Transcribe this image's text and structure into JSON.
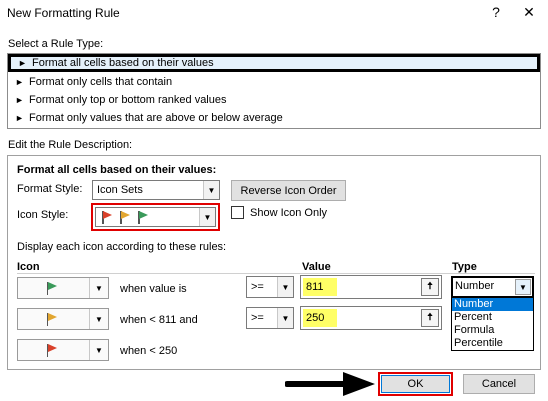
{
  "dialog": {
    "title": "New Formatting Rule",
    "help_glyph": "?",
    "close_glyph": "✕"
  },
  "rule_type": {
    "label": "Select a Rule Type:",
    "items": [
      {
        "label": "Format all cells based on their values",
        "selected": true
      },
      {
        "label": "Format only cells that contain",
        "selected": false
      },
      {
        "label": "Format only top or bottom ranked values",
        "selected": false
      },
      {
        "label": "Format only values that are above or below average",
        "selected": false
      }
    ]
  },
  "description": {
    "label": "Edit the Rule Description:",
    "heading": "Format all cells based on their values:",
    "format_style_label": "Format Style:",
    "format_style_value": "Icon Sets",
    "reverse_button": "Reverse Icon Order",
    "icon_style_label": "Icon Style:",
    "show_icon_only_label": "Show Icon Only",
    "show_icon_only_checked": false,
    "rules_text": "Display each icon according to these rules:",
    "col_icon": "Icon",
    "col_value": "Value",
    "col_type": "Type"
  },
  "rules": [
    {
      "condition": "when value is",
      "operator": ">=",
      "value": "811",
      "type": "Number",
      "flag_color": "#3a9a5a"
    },
    {
      "condition": "when < 811 and",
      "operator": ">=",
      "value": "250",
      "type": "",
      "flag_color": "#e2a630"
    },
    {
      "condition": "when < 250",
      "operator": "",
      "value": "",
      "type": "",
      "flag_color": "#d9412a"
    }
  ],
  "type_dropdown": {
    "options": [
      "Number",
      "Percent",
      "Formula",
      "Percentile"
    ],
    "selected": "Number"
  },
  "buttons": {
    "ok": "OK",
    "cancel": "Cancel"
  },
  "colors": {
    "highlight_red": "#e00000",
    "value_yellow": "#ffff66",
    "selection_blue": "#0078d7",
    "flag_red": "#d9412a",
    "flag_yellow": "#e2a630",
    "flag_green": "#3a9a5a"
  }
}
